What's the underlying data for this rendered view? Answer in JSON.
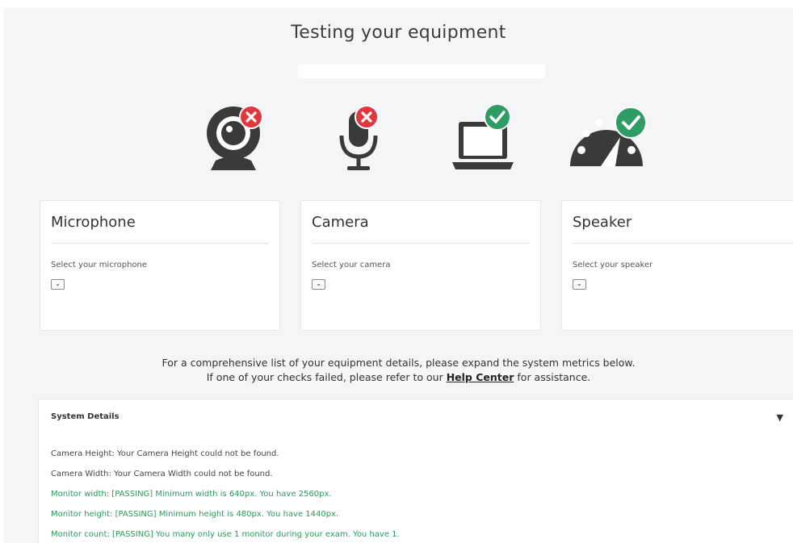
{
  "title": "Testing your equipment",
  "progress": {
    "value": 0
  },
  "status_icons": [
    {
      "name": "webcam-icon",
      "status": "failed"
    },
    {
      "name": "microphone-icon",
      "status": "failed"
    },
    {
      "name": "laptop-icon",
      "status": "passed"
    },
    {
      "name": "speedometer-icon",
      "status": "passed"
    }
  ],
  "colors": {
    "fail": "#e0383e",
    "pass": "#2e9c63",
    "icon": "#3a3a3a",
    "pass_text": "#2a9a5a"
  },
  "cards": [
    {
      "title": "Microphone",
      "label": "Select your microphone",
      "select_value": ""
    },
    {
      "title": "Camera",
      "label": "Select your camera",
      "select_value": ""
    },
    {
      "title": "Speaker",
      "label": "Select your speaker",
      "select_value": ""
    }
  ],
  "info": {
    "line1": "For a comprehensive list of your equipment details, please expand the system metrics below.",
    "line2_before": "If one of your checks failed, please refer to our",
    "help_link": "Help Center",
    "line2_after": "for assistance."
  },
  "system_details": {
    "title": "System Details",
    "toggle_icon": "chevron-down-icon",
    "metrics": [
      {
        "text": "Camera Height: Your Camera Height could not be found.",
        "status": "unknown"
      },
      {
        "text": "Camera Width: Your Camera Width could not be found.",
        "status": "unknown"
      },
      {
        "text": "Monitor width: [PASSING] Minimum width is 640px. You have 2560px.",
        "status": "passing"
      },
      {
        "text": "Monitor height: [PASSING] Minimum height is 480px. You have 1440px.",
        "status": "passing"
      },
      {
        "text": "Monitor count: [PASSING] You many only use 1 monitor during your exam. You have 1.",
        "status": "passing"
      }
    ]
  }
}
